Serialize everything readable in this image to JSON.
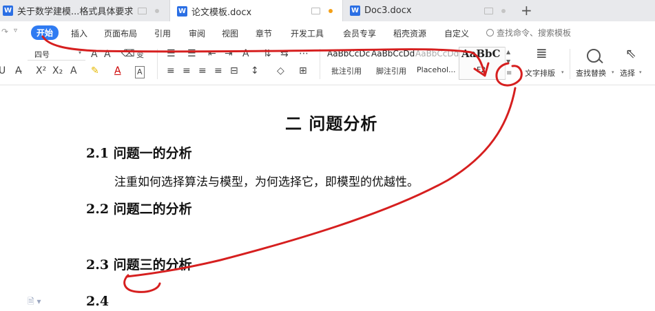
{
  "tabs": [
    {
      "label": "关于数学建模...格式具体要求",
      "icon": "W"
    },
    {
      "label": "论文模板.docx",
      "icon": "W"
    },
    {
      "label": "Doc3.docx",
      "icon": "W"
    }
  ],
  "new_tab_label": "+",
  "menu": {
    "items": [
      "开始",
      "插入",
      "页面布局",
      "引用",
      "审阅",
      "视图",
      "章节",
      "开发工具",
      "会员专享",
      "稻壳资源",
      "自定义"
    ],
    "search_placeholder": "查找命令、搜索模板"
  },
  "toolbar": {
    "font_size": "四号",
    "styles": [
      {
        "sample": "AaBbCcDc",
        "name": "批注引用"
      },
      {
        "sample": "AaBbCcDd",
        "name": "脚注引用"
      },
      {
        "sample": "AaBbCcDd",
        "name": "Placehol..."
      },
      {
        "sample": "AaBbC",
        "name": "F2"
      }
    ],
    "text_layout_label": "文字排版",
    "find_replace_label": "查找替换",
    "select_label": "选择"
  },
  "document": {
    "chapter_title": "二  问题分析",
    "sections": [
      {
        "heading": "2.1 问题一的分析",
        "body": "注重如何选择算法与模型，为何选择它，即模型的优越性。"
      },
      {
        "heading": "2.2 问题二的分析",
        "body": ""
      },
      {
        "heading": "2.3 问题三的分析",
        "body": ""
      },
      {
        "heading": "2.4",
        "body": ""
      }
    ]
  },
  "colors": {
    "accent": "#2f7bf2",
    "annotation": "#d61f1f",
    "tab_modified_dot": "#f4a017"
  }
}
